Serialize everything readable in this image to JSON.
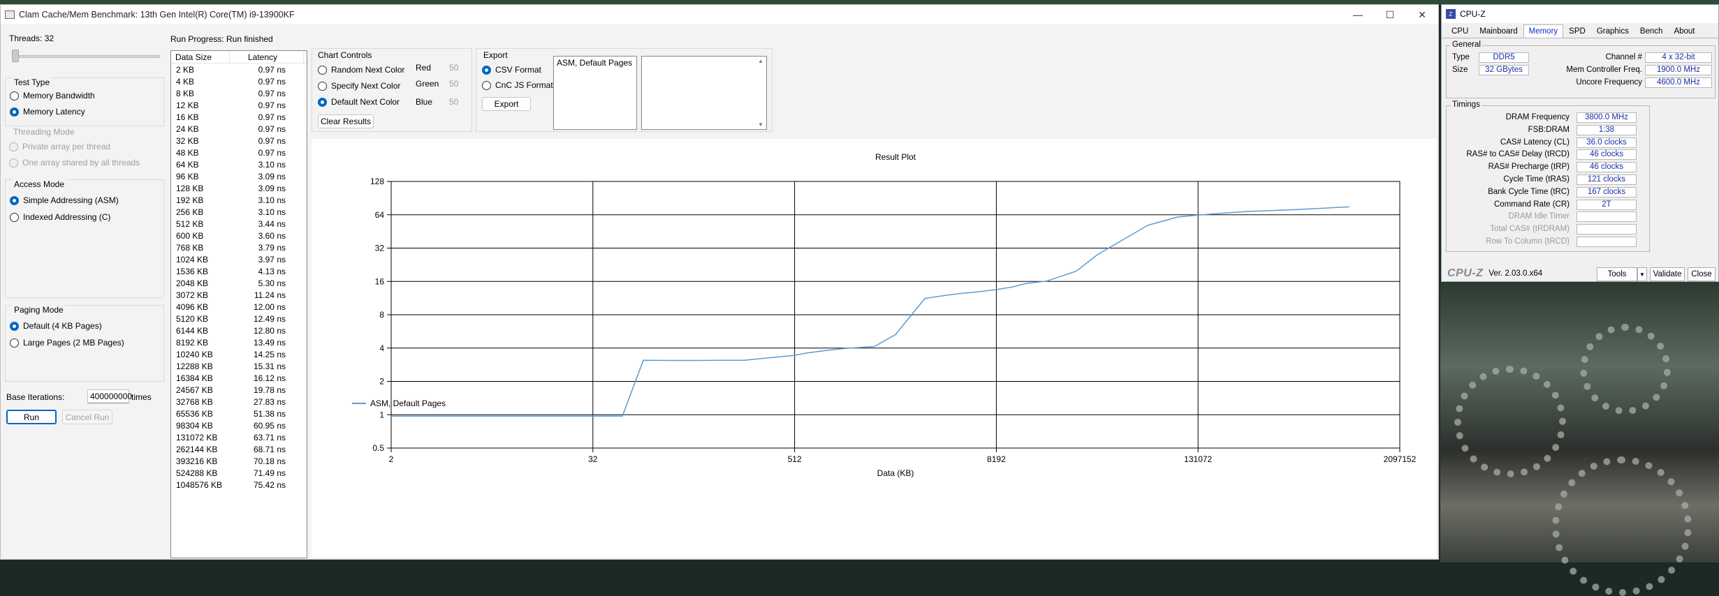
{
  "window": {
    "title": "Clam Cache/Mem Benchmark: 13th Gen Intel(R) Core(TM) i9-13900KF",
    "min": "—",
    "max": "☐",
    "close": "✕"
  },
  "left": {
    "threads_label": "Threads: 32",
    "test_type": {
      "title": "Test Type",
      "options": [
        "Memory Bandwidth",
        "Memory Latency"
      ],
      "selected": 1
    },
    "threading_mode": {
      "title": "Threading Mode",
      "options": [
        "Private array per thread",
        "One array shared by all threads"
      ]
    },
    "access_mode": {
      "title": "Access Mode",
      "options": [
        "Simple Addressing (ASM)",
        "Indexed Addressing (C)"
      ],
      "selected": 0
    },
    "paging_mode": {
      "title": "Paging Mode",
      "options": [
        "Default (4 KB Pages)",
        "Large Pages (2 MB Pages)"
      ],
      "selected": 0
    },
    "base_iterations_label": "Base Iterations:",
    "base_iterations_value": "400000000",
    "times_label": "times",
    "run_label": "Run",
    "cancel_label": "Cancel Run"
  },
  "progress": {
    "label": "Run Progress:",
    "status": "Run finished"
  },
  "table": {
    "headers": [
      "Data Size",
      "Latency"
    ],
    "rows": [
      [
        "2 KB",
        "0.97 ns"
      ],
      [
        "4 KB",
        "0.97 ns"
      ],
      [
        "8 KB",
        "0.97 ns"
      ],
      [
        "12 KB",
        "0.97 ns"
      ],
      [
        "16 KB",
        "0.97 ns"
      ],
      [
        "24 KB",
        "0.97 ns"
      ],
      [
        "32 KB",
        "0.97 ns"
      ],
      [
        "48 KB",
        "0.97 ns"
      ],
      [
        "64 KB",
        "3.10 ns"
      ],
      [
        "96 KB",
        "3.09 ns"
      ],
      [
        "128 KB",
        "3.09 ns"
      ],
      [
        "192 KB",
        "3.10 ns"
      ],
      [
        "256 KB",
        "3.10 ns"
      ],
      [
        "512 KB",
        "3.44 ns"
      ],
      [
        "600 KB",
        "3.60 ns"
      ],
      [
        "768 KB",
        "3.79 ns"
      ],
      [
        "1024 KB",
        "3.97 ns"
      ],
      [
        "1536 KB",
        "4.13 ns"
      ],
      [
        "2048 KB",
        "5.30 ns"
      ],
      [
        "3072 KB",
        "11.24 ns"
      ],
      [
        "4096 KB",
        "12.00 ns"
      ],
      [
        "5120 KB",
        "12.49 ns"
      ],
      [
        "6144 KB",
        "12.80 ns"
      ],
      [
        "8192 KB",
        "13.49 ns"
      ],
      [
        "10240 KB",
        "14.25 ns"
      ],
      [
        "12288 KB",
        "15.31 ns"
      ],
      [
        "16384 KB",
        "16.12 ns"
      ],
      [
        "24567 KB",
        "19.78 ns"
      ],
      [
        "32768 KB",
        "27.83 ns"
      ],
      [
        "65536 KB",
        "51.38 ns"
      ],
      [
        "98304 KB",
        "60.95 ns"
      ],
      [
        "131072 KB",
        "63.71 ns"
      ],
      [
        "262144 KB",
        "68.71 ns"
      ],
      [
        "393216 KB",
        "70.18 ns"
      ],
      [
        "524288 KB",
        "71.49 ns"
      ],
      [
        "1048576 KB",
        "75.42 ns"
      ]
    ]
  },
  "chart_controls": {
    "title": "Chart Controls",
    "options": [
      "Random Next Color",
      "Specify Next Color",
      "Default Next Color"
    ],
    "selected": 2,
    "red_label": "Red",
    "red_value": "50",
    "green_label": "Green",
    "green_value": "50",
    "blue_label": "Blue",
    "blue_value": "50",
    "clear_label": "Clear Results"
  },
  "export": {
    "title": "Export",
    "options": [
      "CSV Format",
      "CnC JS Format"
    ],
    "selected": 0,
    "button_label": "Export",
    "list_items": [
      "ASM, Default Pages"
    ]
  },
  "chart_data": {
    "type": "line",
    "title": "Result Plot",
    "xlabel": "Data (KB)",
    "ylabel": "",
    "x_scale": "log2",
    "y_scale": "log2",
    "xlim": [
      2,
      2097152
    ],
    "ylim": [
      0.5,
      128
    ],
    "x_ticks": [
      "2",
      "32",
      "512",
      "8192",
      "131072",
      "2097152"
    ],
    "y_ticks": [
      "0.5",
      "1",
      "2",
      "4",
      "8",
      "16",
      "32",
      "64",
      "128"
    ],
    "grid": true,
    "legend_position": "bottom-left",
    "series": [
      {
        "name": "ASM, Default Pages",
        "color": "#5b9bd5",
        "x": [
          2,
          4,
          8,
          12,
          16,
          24,
          32,
          48,
          64,
          96,
          128,
          192,
          256,
          512,
          600,
          768,
          1024,
          1536,
          2048,
          3072,
          4096,
          5120,
          6144,
          8192,
          10240,
          12288,
          16384,
          24567,
          32768,
          65536,
          98304,
          131072,
          262144,
          393216,
          524288,
          1048576
        ],
        "y": [
          0.97,
          0.97,
          0.97,
          0.97,
          0.97,
          0.97,
          0.97,
          0.97,
          3.1,
          3.09,
          3.09,
          3.1,
          3.1,
          3.44,
          3.6,
          3.79,
          3.97,
          4.13,
          5.3,
          11.24,
          12.0,
          12.49,
          12.8,
          13.49,
          14.25,
          15.31,
          16.12,
          19.78,
          27.83,
          51.38,
          60.95,
          63.71,
          68.71,
          70.18,
          71.49,
          75.42
        ]
      }
    ]
  },
  "cpuz": {
    "title": "CPU-Z",
    "tabs": [
      "CPU",
      "Mainboard",
      "Memory",
      "SPD",
      "Graphics",
      "Bench",
      "About"
    ],
    "active_tab": 2,
    "general": {
      "title": "General",
      "type_label": "Type",
      "type_value": "DDR5",
      "size_label": "Size",
      "size_value": "32 GBytes",
      "channel_label": "Channel #",
      "channel_value": "4 x 32-bit",
      "mc_freq_label": "Mem Controller Freq.",
      "mc_freq_value": "1900.0 MHz",
      "uncore_label": "Uncore Frequency",
      "uncore_value": "4600.0 MHz"
    },
    "timings": {
      "title": "Timings",
      "rows": [
        {
          "label": "DRAM Frequency",
          "value": "3800.0 MHz"
        },
        {
          "label": "FSB:DRAM",
          "value": "1:38"
        },
        {
          "label": "CAS# Latency (CL)",
          "value": "36.0 clocks"
        },
        {
          "label": "RAS# to CAS# Delay (tRCD)",
          "value": "46 clocks"
        },
        {
          "label": "RAS# Precharge (tRP)",
          "value": "46 clocks"
        },
        {
          "label": "Cycle Time (tRAS)",
          "value": "121 clocks"
        },
        {
          "label": "Bank Cycle Time (tRC)",
          "value": "167 clocks"
        },
        {
          "label": "Command Rate (CR)",
          "value": "2T"
        },
        {
          "label": "DRAM Idle Timer",
          "value": ""
        },
        {
          "label": "Total CAS# (tRDRAM)",
          "value": ""
        },
        {
          "label": "Row To Column (tRCD)",
          "value": ""
        }
      ]
    },
    "logo": "CPU-Z",
    "version": "Ver. 2.03.0.x64",
    "tools_label": "Tools",
    "validate_label": "Validate",
    "close_label": "Close"
  }
}
